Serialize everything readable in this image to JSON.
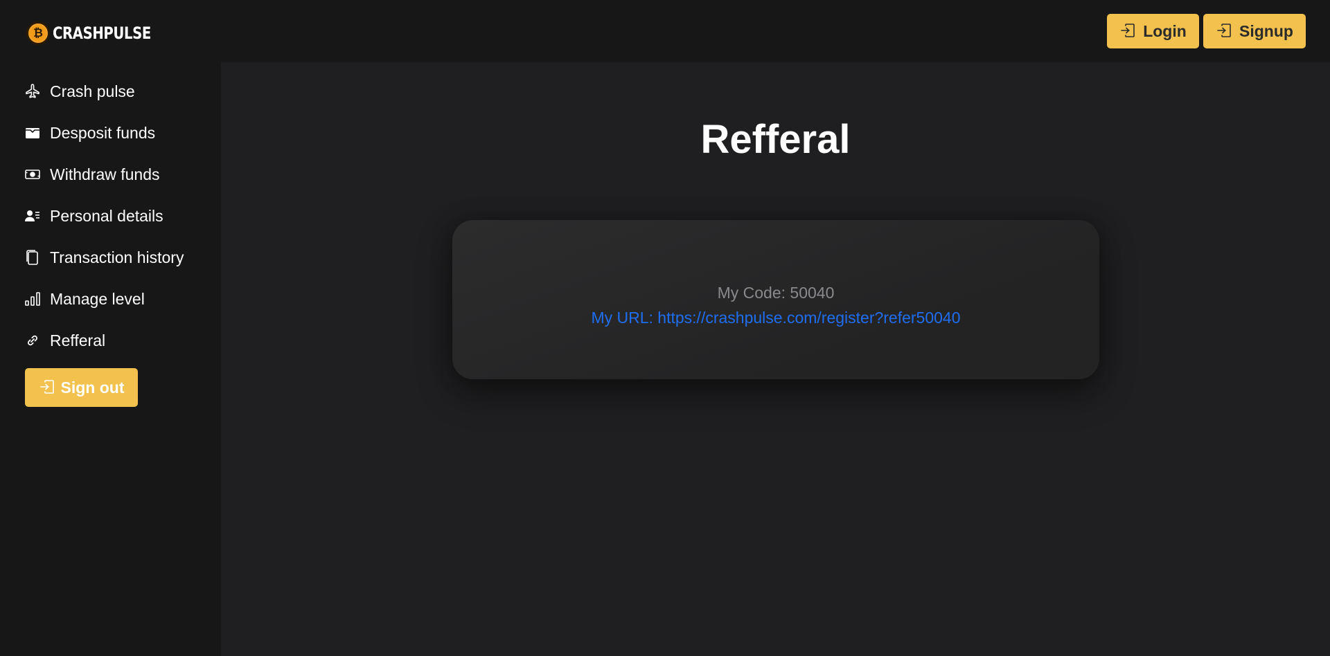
{
  "brand": {
    "name": "CRASHPULSE",
    "coin_symbol": "₿",
    "coin_color": "#f29a1a"
  },
  "sidebar": {
    "items": [
      {
        "label": "Crash pulse",
        "icon": "airplane-icon"
      },
      {
        "label": "Desposit funds",
        "icon": "wallet-icon"
      },
      {
        "label": "Withdraw funds",
        "icon": "cash-icon"
      },
      {
        "label": "Personal details",
        "icon": "person-lines-icon"
      },
      {
        "label": "Transaction history",
        "icon": "files-icon"
      },
      {
        "label": "Manage level",
        "icon": "bar-chart-icon"
      },
      {
        "label": "Refferal",
        "icon": "link-icon"
      }
    ],
    "signout_label": "Sign out"
  },
  "topbar": {
    "login_label": "Login",
    "signup_label": "Signup"
  },
  "main": {
    "title": "Refferal",
    "code_text": "My Code: 50040",
    "url_text": "My URL: https://crashpulse.com/register?refer50040"
  },
  "colors": {
    "accent": "#f2c14e",
    "link": "#1f6ef0",
    "sidebar_bg": "#171718",
    "main_bg": "#1f1f21"
  }
}
